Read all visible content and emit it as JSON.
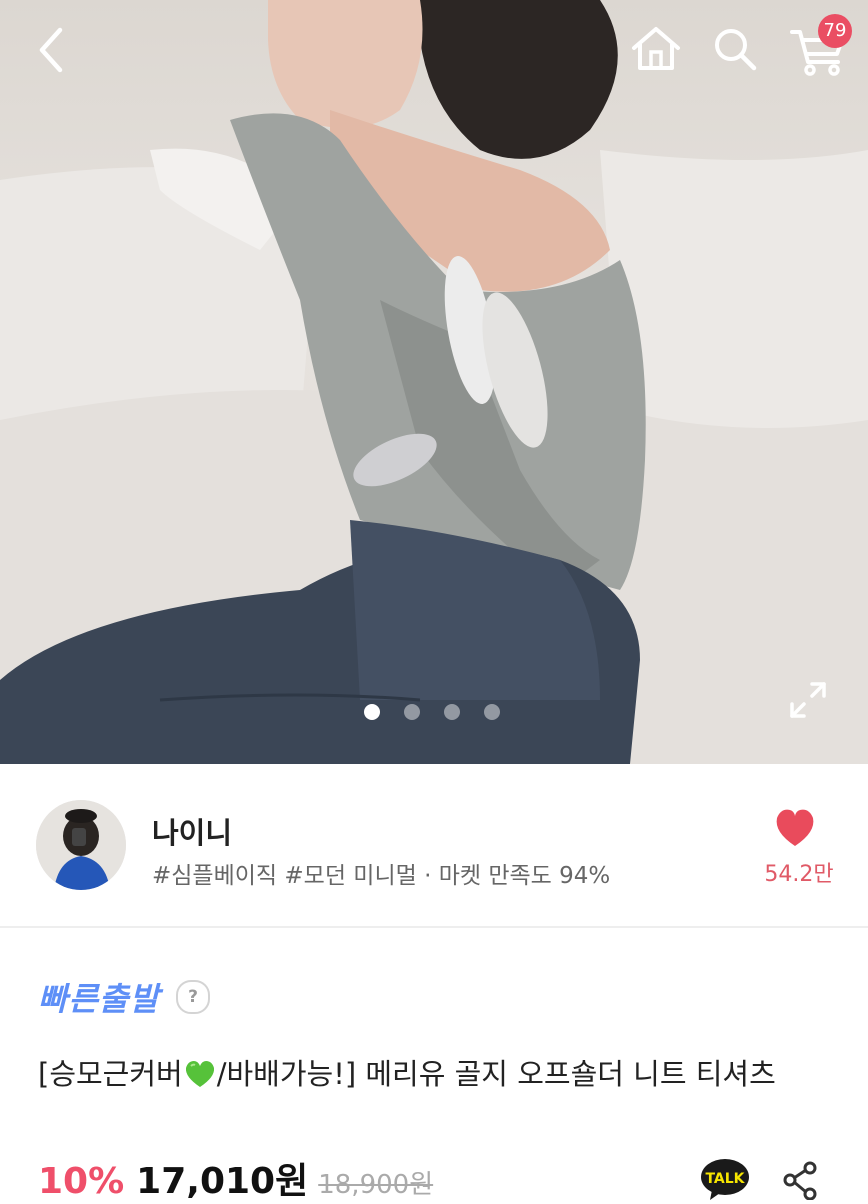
{
  "header": {
    "cart_count": "79"
  },
  "gallery": {
    "slide_count": 4,
    "active_slide": 1
  },
  "seller": {
    "name": "나이니",
    "tags": "#심플베이직 #모던 미니멀 · 마켓 만족도 94%",
    "likes": "54.2만"
  },
  "product": {
    "shipping_badge": "빠른출발",
    "help_label": "?",
    "title_part1": "[승모근커버",
    "title_part2": "/바배가능!] 메리유 골지 오프숄더 니트 티셔츠",
    "discount": "10%",
    "price": "17,010원",
    "original_price": "18,900원",
    "talk_label": "TALK"
  },
  "colors": {
    "accent_pink": "#ef4f6a",
    "like_red": "#e05a67",
    "fast_blue": "#5e8ff7",
    "badge_red": "#ea4e63"
  }
}
